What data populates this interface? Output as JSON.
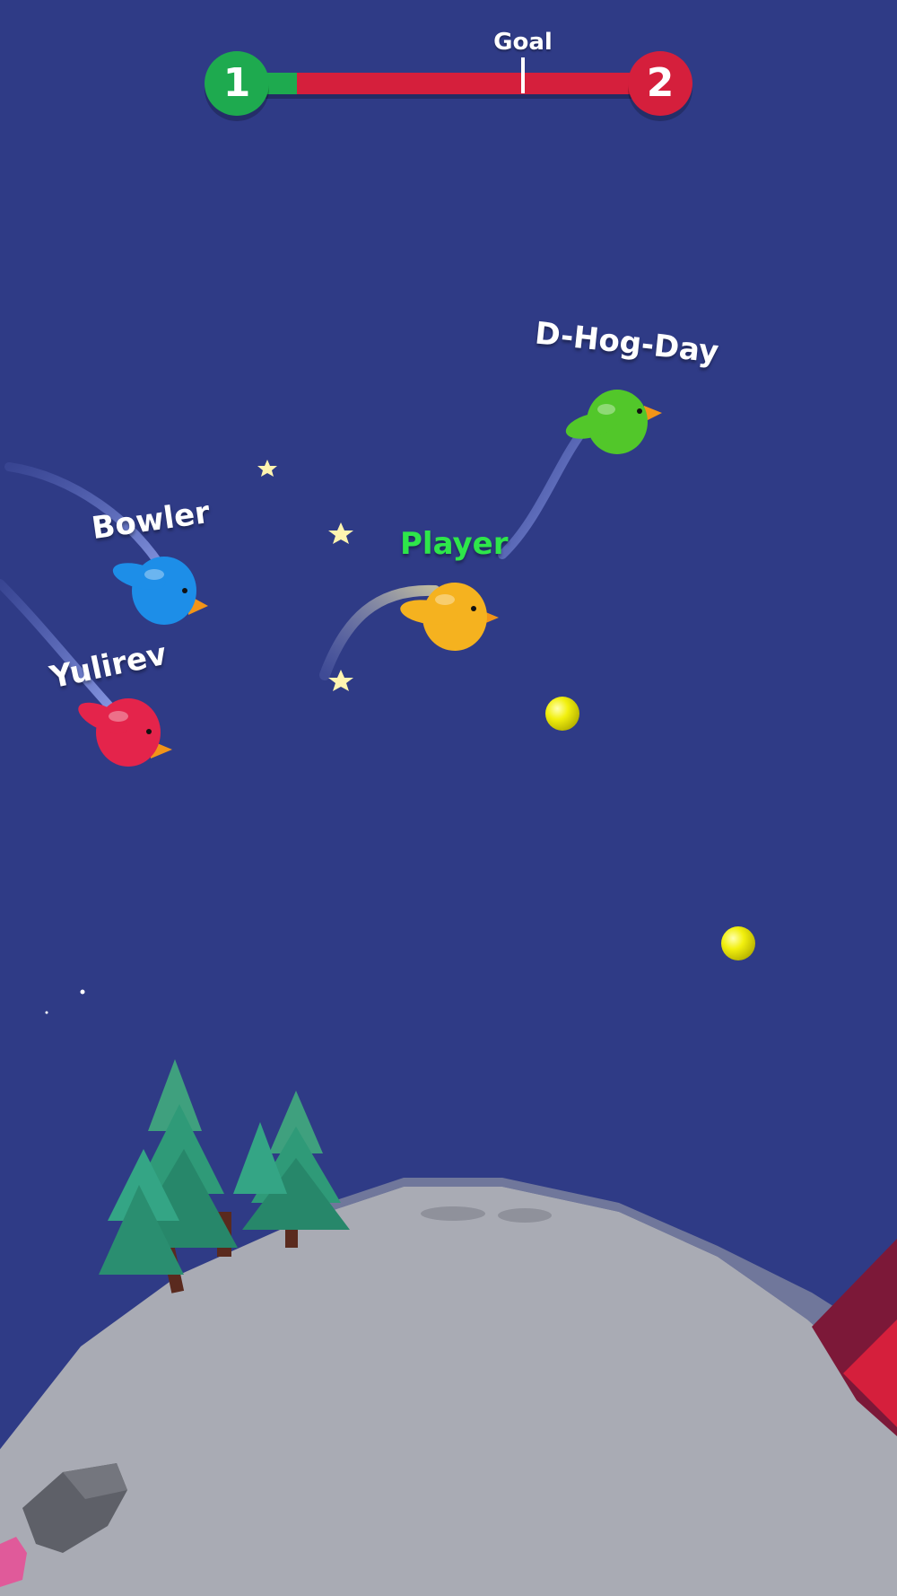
{
  "hud": {
    "current_level": "1",
    "next_level": "2",
    "goal_label": "Goal",
    "progress_fraction": 0.1,
    "goal_fraction": 0.82
  },
  "players": [
    {
      "name": "D-Hog-Day",
      "color": "#52c72a",
      "label_color": "#ffffff",
      "is_self": false
    },
    {
      "name": "Bowler",
      "color": "#1d8ee8",
      "label_color": "#ffffff",
      "is_self": false
    },
    {
      "name": "Player",
      "color": "#f5b21f",
      "label_color": "#2ee64a",
      "is_self": true
    },
    {
      "name": "Yulirev",
      "color": "#e4244b",
      "label_color": "#ffffff",
      "is_self": false
    }
  ],
  "colors": {
    "sky": "#2f3b86",
    "progress_green": "#1eaa4f",
    "progress_red": "#d51f3c",
    "planet": "#a9abb4",
    "tree": "#2f9a78",
    "orb": "#f2f00e"
  }
}
